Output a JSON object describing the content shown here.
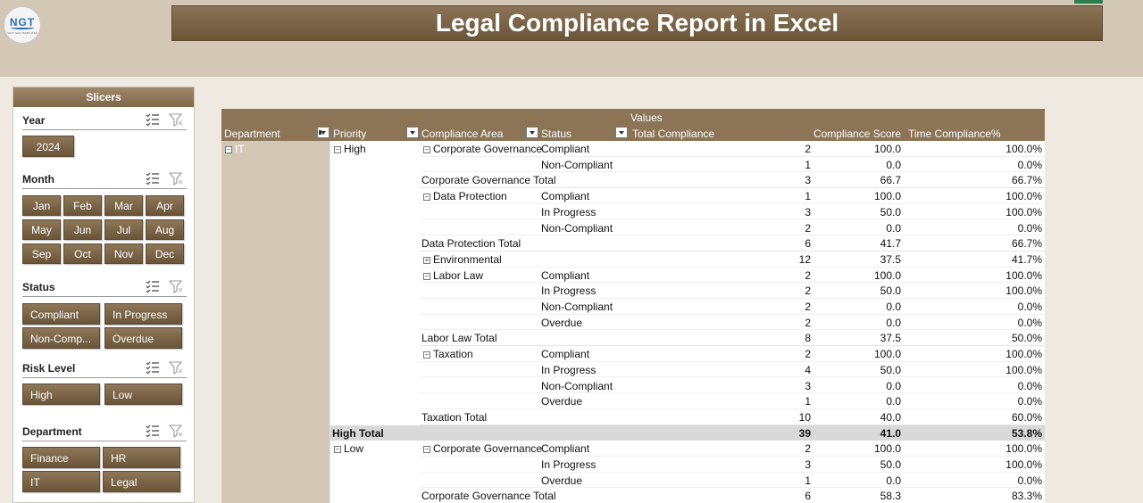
{
  "header": {
    "logo_text": "NGT",
    "logo_subtext": "NEXT GEN TEMPLATES",
    "title": "Legal Compliance Report in Excel"
  },
  "slicers": {
    "panel_title": "Slicers",
    "groups": [
      {
        "label": "Year",
        "items": [
          "2024"
        ]
      },
      {
        "label": "Month",
        "items": [
          "Jan",
          "Feb",
          "Mar",
          "Apr",
          "May",
          "Jun",
          "Jul",
          "Aug",
          "Sep",
          "Oct",
          "Nov",
          "Dec"
        ]
      },
      {
        "label": "Status",
        "items": [
          "Compliant",
          "In Progress",
          "Non-Comp...",
          "Overdue"
        ]
      },
      {
        "label": "Risk Level",
        "items": [
          "High",
          "Low"
        ]
      },
      {
        "label": "Department",
        "items": [
          "Finance",
          "HR",
          "IT",
          "Legal"
        ]
      }
    ]
  },
  "pivot": {
    "values_label": "Values",
    "columns": [
      "Department",
      "Priority",
      "Compliance Area",
      "Status",
      "Total Compliance",
      "Compliance Score",
      "Time Compliance%"
    ],
    "department": "IT",
    "priority_high": "High",
    "priority_low": "Low",
    "rows": [
      {
        "area": "Corporate Governance",
        "status": "Compliant",
        "total": "2",
        "score": "100.0",
        "time": "100.0%",
        "kind": "first"
      },
      {
        "area": "",
        "status": "Non-Compliant",
        "total": "1",
        "score": "0.0",
        "time": "0.0%",
        "kind": "detail"
      },
      {
        "area": "Corporate Governance Total",
        "status": "",
        "total": "3",
        "score": "66.7",
        "time": "66.7%",
        "kind": "sub"
      },
      {
        "area": "Data Protection",
        "status": "Compliant",
        "total": "1",
        "score": "100.0",
        "time": "100.0%",
        "kind": "first"
      },
      {
        "area": "",
        "status": "In Progress",
        "total": "3",
        "score": "50.0",
        "time": "100.0%",
        "kind": "detail"
      },
      {
        "area": "",
        "status": "Non-Compliant",
        "total": "2",
        "score": "0.0",
        "time": "0.0%",
        "kind": "detail"
      },
      {
        "area": "Data Protection Total",
        "status": "",
        "total": "6",
        "score": "41.7",
        "time": "66.7%",
        "kind": "sub"
      },
      {
        "area": "Environmental",
        "status": "",
        "total": "12",
        "score": "37.5",
        "time": "41.7%",
        "kind": "collapsed"
      },
      {
        "area": "Labor Law",
        "status": "Compliant",
        "total": "2",
        "score": "100.0",
        "time": "100.0%",
        "kind": "first"
      },
      {
        "area": "",
        "status": "In Progress",
        "total": "2",
        "score": "50.0",
        "time": "100.0%",
        "kind": "detail"
      },
      {
        "area": "",
        "status": "Non-Compliant",
        "total": "2",
        "score": "0.0",
        "time": "0.0%",
        "kind": "detail"
      },
      {
        "area": "",
        "status": "Overdue",
        "total": "2",
        "score": "0.0",
        "time": "0.0%",
        "kind": "detail"
      },
      {
        "area": "Labor Law Total",
        "status": "",
        "total": "8",
        "score": "37.5",
        "time": "50.0%",
        "kind": "sub"
      },
      {
        "area": "Taxation",
        "status": "Compliant",
        "total": "2",
        "score": "100.0",
        "time": "100.0%",
        "kind": "first"
      },
      {
        "area": "",
        "status": "In Progress",
        "total": "4",
        "score": "50.0",
        "time": "100.0%",
        "kind": "detail"
      },
      {
        "area": "",
        "status": "Non-Compliant",
        "total": "3",
        "score": "0.0",
        "time": "0.0%",
        "kind": "detail"
      },
      {
        "area": "",
        "status": "Overdue",
        "total": "1",
        "score": "0.0",
        "time": "0.0%",
        "kind": "detail"
      },
      {
        "area": "Taxation Total",
        "status": "",
        "total": "10",
        "score": "40.0",
        "time": "60.0%",
        "kind": "sub"
      },
      {
        "area": "High Total",
        "status": "",
        "total": "39",
        "score": "41.0",
        "time": "53.8%",
        "kind": "total"
      },
      {
        "area": "Corporate Governance",
        "status": "Compliant",
        "total": "2",
        "score": "100.0",
        "time": "100.0%",
        "kind": "first"
      },
      {
        "area": "",
        "status": "In Progress",
        "total": "3",
        "score": "50.0",
        "time": "100.0%",
        "kind": "detail"
      },
      {
        "area": "",
        "status": "Overdue",
        "total": "1",
        "score": "0.0",
        "time": "0.0%",
        "kind": "detail"
      },
      {
        "area": "Corporate Governance Total",
        "status": "",
        "total": "6",
        "score": "58.3",
        "time": "83.3%",
        "kind": "sub"
      }
    ]
  }
}
